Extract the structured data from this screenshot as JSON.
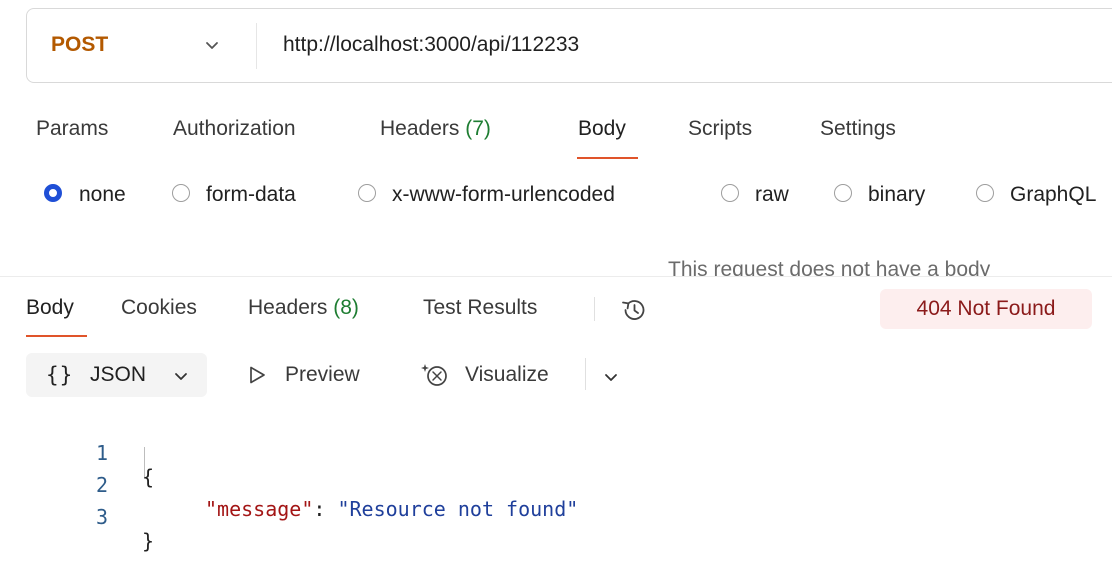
{
  "request": {
    "method": "POST",
    "url": "http://localhost:3000/api/112233",
    "tabs": [
      {
        "label": "Params"
      },
      {
        "label": "Authorization"
      },
      {
        "label": "Headers",
        "count": "(7)"
      },
      {
        "label": "Body"
      },
      {
        "label": "Scripts"
      },
      {
        "label": "Settings"
      }
    ],
    "active_tab": "Body",
    "body_types": [
      "none",
      "form-data",
      "x-www-form-urlencoded",
      "raw",
      "binary",
      "GraphQL"
    ],
    "selected_body_type": "none",
    "empty_message": "This request does not have a body"
  },
  "response": {
    "tabs": [
      {
        "label": "Body"
      },
      {
        "label": "Cookies"
      },
      {
        "label": "Headers",
        "count": "(8)"
      },
      {
        "label": "Test Results"
      }
    ],
    "active_tab": "Body",
    "status": "404 Not Found",
    "format": "JSON",
    "format_braces": "{}",
    "preview_label": "Preview",
    "visualize_label": "Visualize",
    "code_lines": [
      {
        "no": "1",
        "text": "{"
      },
      {
        "no": "2",
        "key": "\"message\"",
        "colon": ": ",
        "value": "\"Resource not found\""
      },
      {
        "no": "3",
        "text": "}"
      }
    ]
  },
  "colors": {
    "method": "#b35900",
    "accent_underline": "#e0542a",
    "radio_selected": "#1f4fd6",
    "count": "#1e7d32",
    "status_bg": "#fdeeee",
    "status_text": "#8b1a1a"
  },
  "icons": [
    "chevron-down-icon",
    "history-icon",
    "preview-play-icon",
    "visualize-icon"
  ]
}
